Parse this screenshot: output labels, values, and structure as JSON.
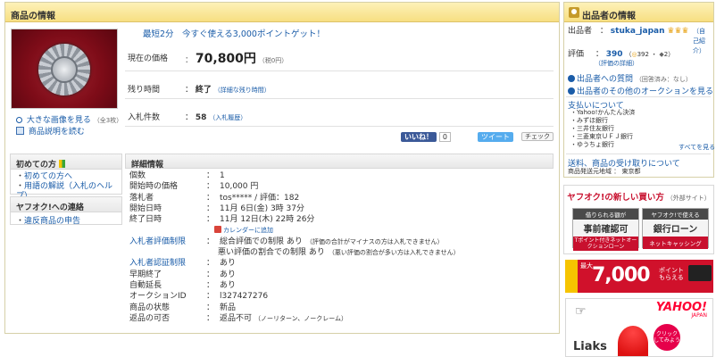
{
  "main": {
    "heading": "商品の情報",
    "promo": "最短2分　今すぐ使える3,000ポイントゲット！",
    "price_label": "現在の価格",
    "price_value": "70,800円",
    "price_tax": "（税0円）",
    "time_label": "残り時間",
    "time_value": "終了",
    "time_detail": "（詳細な残り時間）",
    "bids_label": "入札件数",
    "bids_value": "58",
    "bids_history": "（入札履歴）",
    "enlarge": "大きな画像を見る",
    "enlarge_count": "（全3枚）",
    "read_desc": "商品説明を読む"
  },
  "social": {
    "like": "いいね！",
    "like_count": "0",
    "tweet": "ツイート",
    "check": "チェック"
  },
  "beginner": {
    "title": "初めての方",
    "items": [
      "初めての方へ",
      "用語の解説（入札のヘルプ）"
    ]
  },
  "contact": {
    "title": "ヤフオク!への連絡",
    "items": [
      "違反商品の申告"
    ]
  },
  "details": {
    "title": "詳細情報",
    "rows": [
      {
        "label": "個数",
        "value": "1"
      },
      {
        "label": "開始時の価格",
        "value": "10,000 円"
      },
      {
        "label": "落札者",
        "value": "tos***** / 評価：182"
      },
      {
        "label": "開始日時",
        "value": "11月 6日(金) 3時 37分"
      },
      {
        "label": "終了日時",
        "value": "11月 12日(木) 22時 26分"
      }
    ],
    "calendar": "カレンダーに追加",
    "eval_label": "入札者評価制限",
    "eval_value1": "総合評価での制限 あり",
    "eval_note1": "（評価の合計がマイナスの方は入札できません）",
    "eval_value2": "悪い評価の割合での制限 あり",
    "eval_note2": "（悪い評価の割合が多い方は入札できません）",
    "rows2": [
      {
        "label": "入札者認証制限",
        "value": "あり",
        "link": true
      },
      {
        "label": "早期終了",
        "value": "あり"
      },
      {
        "label": "自動延長",
        "value": "あり"
      },
      {
        "label": "オークションID",
        "value": "l327427276"
      },
      {
        "label": "商品の状態",
        "value": "新品"
      },
      {
        "label": "返品の可否",
        "value": "返品不可",
        "note": "（ノーリターン、ノークレーム）"
      }
    ]
  },
  "seller": {
    "heading": "出品者の情報",
    "name_label": "出品者",
    "name": "stuka_japan",
    "self_intro": "（自己紹介）",
    "rating_label": "評価",
    "rating_value": "390",
    "rating_good": "392",
    "rating_bad": "2",
    "rating_detail": "（評価の詳細）",
    "question": "出品者への質問",
    "question_note": "（回答済み：なし）",
    "other_auctions": "出品者のその他のオークションを見る",
    "payment_title": "支払いについて",
    "payments": [
      "Yahoo!かんたん決済",
      "みずほ銀行",
      "三井住友銀行",
      "三菱東京ＵＦＪ銀行",
      "ゆうちょ銀行"
    ],
    "all_see": "すべてを見る",
    "shipping": "送料、商品の受け取りについて",
    "origin": "商品発送元地域 ： 東京都"
  },
  "ad1": {
    "title": "ヤフオク!の新しい買い方",
    "sub": "（外部サイト）",
    "left_top": "借りられる額が",
    "left_main": "事前確認可",
    "left_bottom": "Tポイント付きネットオークションローン",
    "right_top": "ヤフオク!で使える",
    "right_main": "銀行ローン",
    "right_bottom": "ネットキャッシング"
  },
  "ad2": {
    "max": "最大",
    "points": "7,000",
    "points_label": "ポイントもらえる"
  },
  "ad3": {
    "brand": "YAHOO!",
    "brand_sub": "JAPAN",
    "click": "クリックしてみよう",
    "partial": "Liaks"
  }
}
